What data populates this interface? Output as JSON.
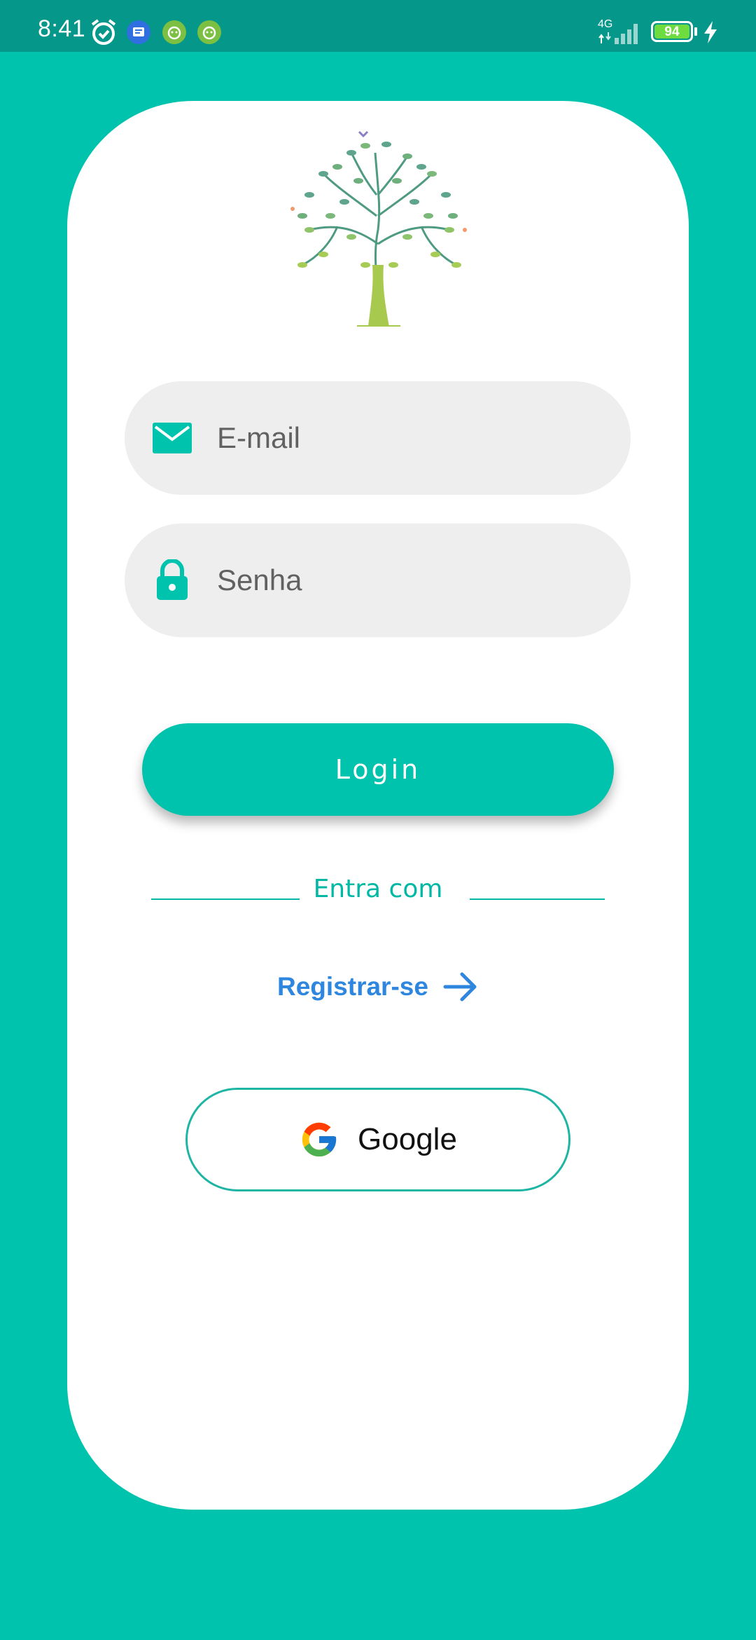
{
  "status_bar": {
    "time": "8:41",
    "network": "4G",
    "battery": "94"
  },
  "form": {
    "email_placeholder": "E-mail",
    "password_placeholder": "Senha",
    "login_label": "Login",
    "divider_label": "Entra com",
    "register_label": "Registrar-se",
    "google_label": "Google"
  },
  "colors": {
    "background": "#00C3AD",
    "status_bar": "#05978A",
    "accent": "#00C3AD",
    "link": "#2E86DE",
    "field_bg": "#EEEEEE"
  },
  "icons": {
    "email_field": "envelope-icon",
    "password_field": "lock-icon",
    "register": "arrow-right-icon",
    "google": "google-icon",
    "logo": "tree-logo"
  }
}
